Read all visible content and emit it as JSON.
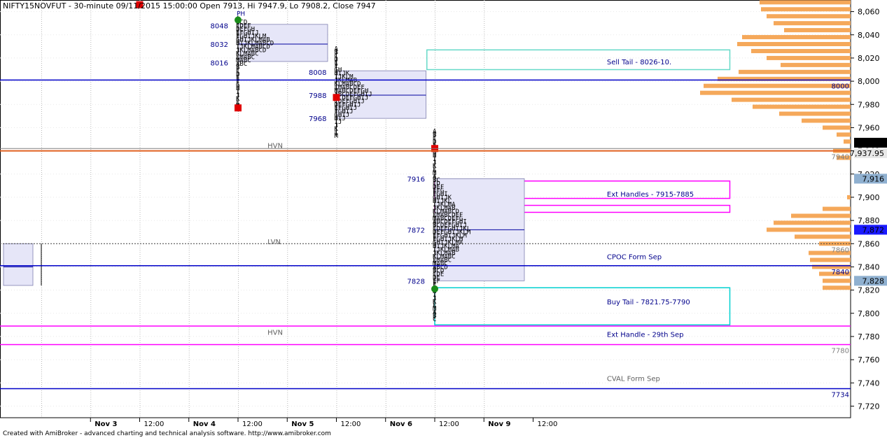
{
  "chart_data": {
    "type": "market-profile",
    "title": "NIFTY15NOVFUT - 30-minute 09/11/2015 15:00:00 Open 7913, Hi 7947.9, Lo 7908.2, Close 7947",
    "footer": "Created with AmiBroker - advanced charting and technical analysis software. http://www.amibroker.com",
    "ylim": [
      7710,
      8070
    ],
    "y_ticks": [
      "7,720",
      "7,740",
      "7,760",
      "7,780",
      "7,800",
      "7,820",
      "7,840",
      "7,860",
      "7,880",
      "7,900",
      "7,920",
      "7,940",
      "7,960",
      "7,980",
      "8,000",
      "8,020",
      "8,040",
      "8,060"
    ],
    "y_tick_values": [
      7720,
      7740,
      7760,
      7780,
      7800,
      7820,
      7840,
      7860,
      7880,
      7900,
      7920,
      7940,
      7960,
      7980,
      8000,
      8020,
      8040,
      8060
    ],
    "x_labels": [
      {
        "text": "Nov 3",
        "slot": 0.5,
        "bold": true
      },
      {
        "text": "12:00",
        "slot": 1.0,
        "bold": false
      },
      {
        "text": "Nov 4",
        "slot": 1.5,
        "bold": true
      },
      {
        "text": "12:00",
        "slot": 2.0,
        "bold": false
      },
      {
        "text": "Nov 5",
        "slot": 2.5,
        "bold": true
      },
      {
        "text": "12:00",
        "slot": 3.0,
        "bold": false
      },
      {
        "text": "Nov 6",
        "slot": 3.5,
        "bold": true
      },
      {
        "text": "12:00",
        "slot": 4.0,
        "bold": false
      },
      {
        "text": "Nov 9",
        "slot": 4.5,
        "bold": true
      },
      {
        "text": "12:00",
        "slot": 5.0,
        "bold": false
      }
    ],
    "price_badges": [
      {
        "text": "7,947",
        "value": 7947,
        "bg": "#000000",
        "fg": "#ffffff"
      },
      {
        "text": "7,937.95",
        "value": 7937.95,
        "bg": "#e8e8e8",
        "fg": "#000000"
      },
      {
        "text": "7,916",
        "value": 7916,
        "bg": "#8fb0d0",
        "fg": "#000000"
      },
      {
        "text": "7,872",
        "value": 7872,
        "bg": "#1a1aff",
        "fg": "#ffffff"
      },
      {
        "text": "7,828",
        "value": 7828,
        "bg": "#8fb0d0",
        "fg": "#000000"
      }
    ],
    "hlines": [
      {
        "value": 8001,
        "color": "#0000c8",
        "width": 1.5,
        "dash": false,
        "label": "8000",
        "label_color": "#00008b"
      },
      {
        "value": 7942,
        "color": "#808080",
        "width": 1,
        "dash": false,
        "label": "",
        "label_color": "#000"
      },
      {
        "value": 7940,
        "color": "#e06020",
        "width": 2,
        "dash": false,
        "label": "7940",
        "label_color": "#808080"
      },
      {
        "value": 7860,
        "color": "#404040",
        "width": 1,
        "dash": true,
        "label": "7860",
        "label_color": "#808080"
      },
      {
        "value": 7841,
        "color": "#0000c8",
        "width": 1.5,
        "dash": false,
        "label": "7840",
        "label_color": "#00008b"
      },
      {
        "value": 7789,
        "color": "#ff00ff",
        "width": 1.5,
        "dash": false,
        "label": "",
        "label_color": "#000"
      },
      {
        "value": 7773,
        "color": "#ff00ff",
        "width": 1.5,
        "dash": false,
        "label": "7780",
        "label_color": "#808080"
      },
      {
        "value": 7735,
        "color": "#0000c8",
        "width": 1.5,
        "dash": false,
        "label": "7734",
        "label_color": "#00008b"
      }
    ],
    "annotations": [
      {
        "text": "Sell Tail - 8026-10.",
        "value": 8017,
        "slot": 5.75,
        "color": "#00008b"
      },
      {
        "text": "Ext Handles - 7915-7885",
        "value": 7903,
        "slot": 5.75,
        "color": "#00008b"
      },
      {
        "text": "CPOC Form Sep",
        "value": 7849,
        "slot": 5.75,
        "color": "#00008b"
      },
      {
        "text": "Buy Tail - 7821.75-7790",
        "value": 7810,
        "slot": 5.75,
        "color": "#00008b"
      },
      {
        "text": "Ext Handle - 29th Sep",
        "value": 7782,
        "slot": 5.75,
        "color": "#00008b"
      },
      {
        "text": "CVAL Form Sep",
        "value": 7744,
        "slot": 5.75,
        "color": "#606060"
      },
      {
        "text": "HVN",
        "value": 7945,
        "slot": 2.3,
        "color": "#606060"
      },
      {
        "text": "LVN",
        "value": 7862,
        "slot": 2.3,
        "color": "#606060"
      },
      {
        "text": "HVN",
        "value": 7784,
        "slot": 2.3,
        "color": "#606060"
      }
    ],
    "boxes": [
      {
        "slot_from": 3.92,
        "slot_to": 7.0,
        "lo": 8010,
        "hi": 8027,
        "color": "#66d9c8"
      },
      {
        "slot_from": 4.0,
        "slot_to": 7.0,
        "lo": 7899,
        "hi": 7914,
        "color": "#ff00ff"
      },
      {
        "slot_from": 4.0,
        "slot_to": 7.0,
        "lo": 7887,
        "hi": 7893,
        "color": "#ff00ff"
      },
      {
        "slot_from": 4.0,
        "slot_to": 7.0,
        "lo": 7790,
        "hi": 7822,
        "color": "#00d0d0"
      }
    ],
    "profiles": [
      {
        "day": "Nov 3",
        "slot": 0,
        "va_lo": 7824,
        "va_hi": 7860,
        "poc": 7840,
        "high": 7860,
        "low": 7824,
        "labels": []
      },
      {
        "day": "Nov 5",
        "slot": 2,
        "va_lo": 8017,
        "va_hi": 8049,
        "poc": 8032,
        "high": 8054,
        "low": 7974,
        "labels": [
          {
            "text": "8048",
            "value": 8048
          },
          {
            "text": "8032",
            "value": 8032
          },
          {
            "text": "8016",
            "value": 8016
          }
        ],
        "tag": "PH"
      },
      {
        "day": "Nov 6",
        "slot": 3,
        "va_lo": 7968,
        "va_hi": 8009,
        "poc": 7988,
        "high": 8028,
        "low": 7952,
        "labels": [
          {
            "text": "8008",
            "value": 8008
          },
          {
            "text": "7988",
            "value": 7988
          },
          {
            "text": "7968",
            "value": 7968
          }
        ]
      },
      {
        "day": "Nov 9",
        "slot": 4,
        "va_lo": 7828,
        "va_hi": 7916,
        "poc": 7872,
        "high": 7957,
        "low": 7795,
        "labels": [
          {
            "text": "7916",
            "value": 7916
          },
          {
            "text": "7872",
            "value": 7872
          },
          {
            "text": "7828",
            "value": 7828
          }
        ]
      }
    ],
    "volume_profile": [
      [
        8068,
        130
      ],
      [
        8062,
        128
      ],
      [
        8056,
        120
      ],
      [
        8050,
        110
      ],
      [
        8044,
        95
      ],
      [
        8038,
        155
      ],
      [
        8032,
        162
      ],
      [
        8026,
        142
      ],
      [
        8020,
        120
      ],
      [
        8014,
        100
      ],
      [
        8008,
        160
      ],
      [
        8002,
        190
      ],
      [
        7996,
        210
      ],
      [
        7990,
        215
      ],
      [
        7984,
        170
      ],
      [
        7978,
        140
      ],
      [
        7972,
        102
      ],
      [
        7966,
        70
      ],
      [
        7960,
        40
      ],
      [
        7954,
        20
      ],
      [
        7948,
        10
      ],
      [
        7940,
        25
      ],
      [
        7934,
        20
      ],
      [
        7900,
        5
      ],
      [
        7890,
        40
      ],
      [
        7884,
        85
      ],
      [
        7878,
        110
      ],
      [
        7872,
        120
      ],
      [
        7866,
        80
      ],
      [
        7860,
        45
      ],
      [
        7852,
        60
      ],
      [
        7846,
        58
      ],
      [
        7840,
        55
      ],
      [
        7834,
        45
      ],
      [
        7828,
        40
      ],
      [
        7822,
        40
      ]
    ]
  }
}
